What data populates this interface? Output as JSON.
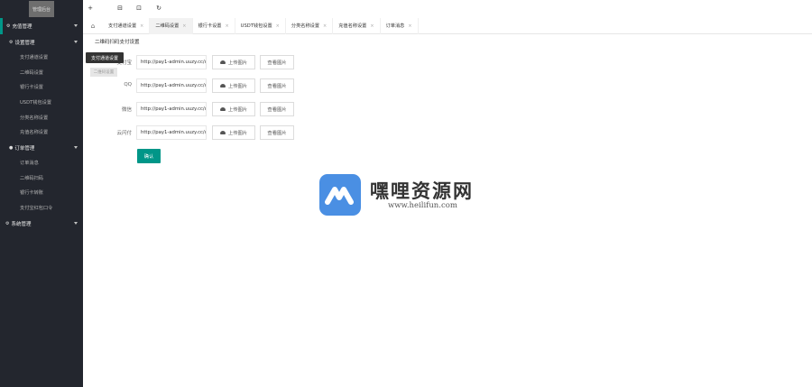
{
  "sidebar": {
    "logo_text": "管理后台",
    "groups": [
      {
        "label": "充值管理",
        "icon": "gear-icon",
        "sub": [
          {
            "label": "设置管理",
            "icon": "gear-icon",
            "items": [
              "支付通道设置",
              "二维码设置",
              "银行卡设置",
              "USDT钱包设置",
              "分类名称设置",
              "充值名称设置"
            ]
          },
          {
            "label": "订单管理",
            "icon": "user-icon",
            "items": [
              "订单消息",
              "二维码扫码",
              "银行卡转账",
              "支付宝红包口令"
            ]
          }
        ]
      },
      {
        "label": "系统管理",
        "icon": "gear-icon"
      }
    ]
  },
  "header": {
    "buttons": [
      "+",
      "⊟",
      "⊡",
      "↻"
    ]
  },
  "tabs": [
    {
      "label": "支付通道设置",
      "active": false
    },
    {
      "label": "二维码设置",
      "active": true
    },
    {
      "label": "银行卡设置",
      "active": false
    },
    {
      "label": "USDT钱包设置",
      "active": false
    },
    {
      "label": "分类名称设置",
      "active": false
    },
    {
      "label": "充值名称设置",
      "active": false
    },
    {
      "label": "订单消息",
      "active": false
    }
  ],
  "tooltip": {
    "text": "支付通道设置",
    "ghost": "二维码设置"
  },
  "form": {
    "title": "二维码扫码支付设置",
    "rows": [
      {
        "label": "支付宝",
        "value": "http://pay1-admin.uuzy.cc/up",
        "upload": "上传图片",
        "view": "查看图片"
      },
      {
        "label": "QQ",
        "value": "http://pay1-admin.uuzy.cc/up",
        "upload": "上传图片",
        "view": "查看图片"
      },
      {
        "label": "微信",
        "value": "http://pay1-admin.uuzy.cc/up",
        "upload": "上传图片",
        "view": "查看图片"
      },
      {
        "label": "云闪付",
        "value": "http://pay1-admin.uuzy.cc/up",
        "upload": "上传图片",
        "view": "查看图片"
      }
    ],
    "submit": "确认"
  },
  "watermark": {
    "name": "嘿哩资源网",
    "url": "www.heilifun.com"
  },
  "colors": {
    "accent": "#009688",
    "sidebar": "#23262e"
  }
}
